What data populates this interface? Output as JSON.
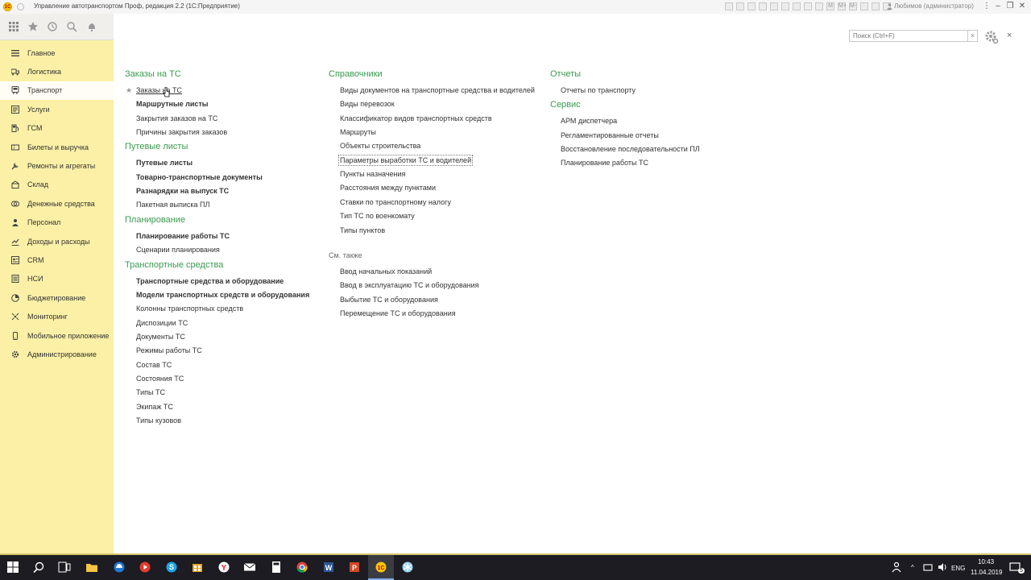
{
  "window": {
    "title": "Управление автотранспортом Проф, редакция 2.2  (1С:Предприятие)",
    "user": "Любимов (администратор)",
    "logo_text": "1С",
    "toolbar_letters": [
      "M",
      "M+",
      "M-"
    ]
  },
  "sidebar": {
    "items": [
      {
        "label": "Главное",
        "icon": "menu-lines-icon"
      },
      {
        "label": "Логистика",
        "icon": "logistics-icon"
      },
      {
        "label": "Транспорт",
        "icon": "truck-icon",
        "active": true
      },
      {
        "label": "Услуги",
        "icon": "services-icon"
      },
      {
        "label": "ГСМ",
        "icon": "fuel-icon"
      },
      {
        "label": "Билеты и выручка",
        "icon": "tickets-icon"
      },
      {
        "label": "Ремонты и агрегаты",
        "icon": "repair-icon"
      },
      {
        "label": "Склад",
        "icon": "warehouse-icon"
      },
      {
        "label": "Денежные средства",
        "icon": "money-icon"
      },
      {
        "label": "Персонал",
        "icon": "personnel-icon"
      },
      {
        "label": "Доходы и расходы",
        "icon": "income-expense-icon"
      },
      {
        "label": "CRM",
        "icon": "crm-icon"
      },
      {
        "label": "НСИ",
        "icon": "reference-data-icon"
      },
      {
        "label": "Бюджетирование",
        "icon": "budget-icon"
      },
      {
        "label": "Мониторинг",
        "icon": "monitoring-icon"
      },
      {
        "label": "Мобильное приложение",
        "icon": "mobile-icon"
      },
      {
        "label": "Администрирование",
        "icon": "admin-gear-icon"
      }
    ]
  },
  "search": {
    "placeholder": "Поиск (Ctrl+F)",
    "clear": "×"
  },
  "close": "×",
  "columns": {
    "col1": {
      "sections": [
        {
          "title": "Заказы на ТС",
          "links": [
            {
              "label": "Заказы на ТС",
              "bold": false,
              "favorite": true,
              "underline": true
            },
            {
              "label": "Маршрутные листы",
              "bold": true
            },
            {
              "label": "Закрытия заказов на ТС",
              "bold": false
            },
            {
              "label": "Причины закрытия заказов",
              "bold": false
            }
          ]
        },
        {
          "title": "Путевые листы",
          "links": [
            {
              "label": "Путевые листы",
              "bold": true
            },
            {
              "label": "Товарно-транспортные документы",
              "bold": true
            },
            {
              "label": "Разнарядки на выпуск ТС",
              "bold": true
            },
            {
              "label": "Пакетная выписка ПЛ",
              "bold": false
            }
          ]
        },
        {
          "title": "Планирование",
          "links": [
            {
              "label": "Планирование работы ТС",
              "bold": true
            },
            {
              "label": "Сценарии планирования",
              "bold": false
            }
          ]
        },
        {
          "title": "Транспортные средства",
          "links": [
            {
              "label": "Транспортные средства и оборудование",
              "bold": true
            },
            {
              "label": "Модели транспортных средств и оборудования",
              "bold": true
            },
            {
              "label": "Колонны транспортных средств",
              "bold": false
            },
            {
              "label": "Диспозиции ТС",
              "bold": false
            },
            {
              "label": "Документы ТС",
              "bold": false
            },
            {
              "label": "Режимы работы ТС",
              "bold": false
            },
            {
              "label": "Состав ТС",
              "bold": false
            },
            {
              "label": "Состояния ТС",
              "bold": false
            },
            {
              "label": "Типы ТС",
              "bold": false
            },
            {
              "label": "Экипаж ТС",
              "bold": false
            },
            {
              "label": "Типы кузовов",
              "bold": false
            }
          ]
        }
      ]
    },
    "col2": {
      "sections": [
        {
          "title": "Справочники",
          "links": [
            {
              "label": "Виды документов на транспортные средства и водителей"
            },
            {
              "label": "Виды перевозок"
            },
            {
              "label": "Классификатор видов транспортных средств"
            },
            {
              "label": "Маршруты"
            },
            {
              "label": "Объекты строительства"
            },
            {
              "label": "Параметры выработки ТС и водителей",
              "focused": true
            },
            {
              "label": "Пункты назначения"
            },
            {
              "label": "Расстояния между пунктами"
            },
            {
              "label": "Ставки по транспортному налогу"
            },
            {
              "label": "Тип ТС по военкомату"
            },
            {
              "label": "Типы пунктов"
            }
          ]
        }
      ],
      "see_also": {
        "title": "См. также",
        "links": [
          {
            "label": "Ввод начальных показаний"
          },
          {
            "label": "Ввод в эксплуатацию ТС и оборудования"
          },
          {
            "label": "Выбытие ТС и оборудования"
          },
          {
            "label": "Перемещение ТС и оборудования"
          }
        ]
      }
    },
    "col3": {
      "sections": [
        {
          "title": "Отчеты",
          "links": [
            {
              "label": "Отчеты по транспорту"
            }
          ]
        },
        {
          "title": "Сервис",
          "links": [
            {
              "label": "АРМ диспетчера"
            },
            {
              "label": "Регламентированные отчеты"
            },
            {
              "label": "Восстановление последовательности ПЛ"
            },
            {
              "label": "Планирование работы ТС"
            }
          ]
        }
      ]
    }
  },
  "colors": {
    "section_title": "#3a9a4f",
    "sidebar_bg": "#fbf0a6",
    "sidebar_active": "#fffdf5",
    "taskbar_bg": "#1c1c22"
  },
  "taskbar": {
    "lang": "ENG",
    "time": "10:43",
    "date": "11.04.2019",
    "notifications": "5",
    "apps": [
      "start-icon",
      "search-icon",
      "task-view-icon",
      "file-explorer-icon",
      "edge-icon",
      "media-icon",
      "skype-icon",
      "store-icon",
      "yandex-icon",
      "mail-icon",
      "calculator-icon",
      "chrome-icon",
      "word-icon",
      "powerpoint-icon",
      "onec-icon",
      "snowflake-icon"
    ]
  }
}
